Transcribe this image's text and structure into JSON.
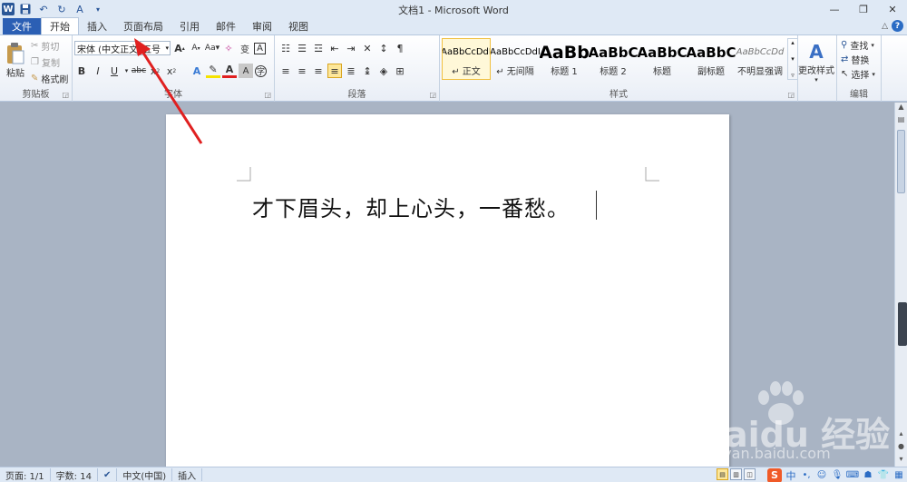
{
  "title_bar": {
    "title": "文档1 - Microsoft Word",
    "quick_access": [
      "word-logo",
      "save-icon",
      "undo-icon",
      "redo-icon",
      "spell-check-icon",
      "customize-icon"
    ]
  },
  "tabs": {
    "file": "文件",
    "items": [
      "开始",
      "插入",
      "页面布局",
      "引用",
      "邮件",
      "审阅",
      "视图"
    ],
    "active": "开始"
  },
  "clipboard": {
    "paste": "粘贴",
    "cut": "剪切",
    "copy": "复制",
    "format_painter": "格式刷",
    "label": "剪贴板"
  },
  "font": {
    "font_name": "宋体 (中文正文",
    "font_size": "五号",
    "label": "字体"
  },
  "paragraph": {
    "label": "段落"
  },
  "styles": {
    "label": "样式",
    "items": [
      {
        "preview": "AaBbCcDdI",
        "name": "↵ 正文"
      },
      {
        "preview": "AaBbCcDdI",
        "name": "↵ 无间隔"
      },
      {
        "preview": "AaBb",
        "name": "标题 1"
      },
      {
        "preview": "AaBbC",
        "name": "标题 2"
      },
      {
        "preview": "AaBbC",
        "name": "标题"
      },
      {
        "preview": "AaBbC",
        "name": "副标题"
      },
      {
        "preview": "AaBbCcDd",
        "name": "不明显强调"
      }
    ],
    "change_styles": "更改样式"
  },
  "editing": {
    "find": "查找",
    "replace": "替换",
    "select": "选择",
    "label": "编辑"
  },
  "document": {
    "text": "才下眉头，却上心头，一番愁。"
  },
  "status_bar": {
    "page": "页面: 1/1",
    "words": "字数: 14",
    "language": "中文(中国)",
    "mode": "插入"
  },
  "tray": {
    "ime": "中"
  },
  "watermark": {
    "brand": "Baidu 经验",
    "url": "jingyan.baidu.com"
  },
  "colors": {
    "file_tab": "#2b5fb4",
    "arrow": "#e02020",
    "font_color_bar": "#e02020",
    "highlight_bar": "#f5e300"
  }
}
